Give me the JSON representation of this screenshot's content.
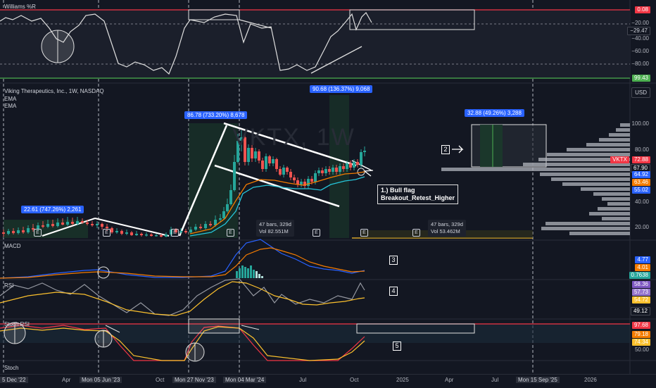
{
  "williams": {
    "title": "Williams %R",
    "value_top": "0.08",
    "value_bottom": "99.43",
    "ticks": [
      "−20.00",
      "−29.47",
      "−40.00",
      "−60.00",
      "−80.00"
    ]
  },
  "main": {
    "title": "Viking Therapeutics, Inc., 1W, NASDAQ",
    "ema1": "EMA",
    "ema2": "EMA",
    "currency": "USD",
    "watermark": "VKTX, 1W",
    "symbol_tag": "VKTX",
    "ticks": [
      "100.00",
      "80.00",
      "60.00",
      "40.00",
      "20.00"
    ],
    "price_tags": [
      {
        "value": "72.88",
        "color": "#f23645"
      },
      {
        "value": "67.90",
        "color": "#131722"
      },
      {
        "value": "64.92",
        "color": "#2962ff"
      },
      {
        "value": "63.46",
        "color": "#f57c00"
      },
      {
        "value": "55.02",
        "color": "#2962ff"
      }
    ],
    "measure1": "22.61 (747.26%) 2,261",
    "measure2": "86.78 (733.20%) 8,678",
    "measure3": "90.68 (136.37%) 9,068",
    "measure4": "32.88 (49.26%) 3,288",
    "bars1_line1": "47 bars, 329d",
    "bars1_line2": "Vol 82.551M",
    "bars2_line1": "47 bars, 329d",
    "bars2_line2": "Vol 53.462M",
    "note_line1": "1.) Bull flag",
    "note_line2": "Breakout_Retest_Higher",
    "marker2": "2",
    "earnings": "E"
  },
  "macd": {
    "title": "MACD",
    "marker": "3",
    "values": [
      {
        "v": "4.77",
        "c": "#2962ff"
      },
      {
        "v": "4.01",
        "c": "#f57c00"
      },
      {
        "v": "0.7638",
        "c": "#26a69a"
      }
    ]
  },
  "rsi": {
    "title": "RSI",
    "marker": "4",
    "values": [
      {
        "v": "58.36",
        "c": "#7e57c2"
      },
      {
        "v": "57.73",
        "c": "#9575cd"
      },
      {
        "v": "54.72",
        "c": "#fbc02d"
      },
      {
        "v": "49.12",
        "c": "#131722"
      }
    ]
  },
  "stoch_rsi": {
    "title": "Stoch RSI",
    "marker": "5",
    "values": [
      {
        "v": "97.68",
        "c": "#f23645"
      },
      {
        "v": "79.18",
        "c": "#f57c00"
      },
      {
        "v": "74.34",
        "c": "#fbc02d"
      }
    ],
    "tick": "50.00"
  },
  "stoch": {
    "title": "Stoch"
  },
  "timeline": [
    {
      "t": "5 Dec '22",
      "hi": true
    },
    {
      "t": "Apr",
      "hi": false
    },
    {
      "t": "Mon 05 Jun '23",
      "hi": true
    },
    {
      "t": "Oct",
      "hi": false
    },
    {
      "t": "Mon 27 Nov '23",
      "hi": true
    },
    {
      "t": "Mon 04 Mar '24",
      "hi": true
    },
    {
      "t": "Jul",
      "hi": false
    },
    {
      "t": "Oct",
      "hi": false
    },
    {
      "t": "2025",
      "hi": false
    },
    {
      "t": "Apr",
      "hi": false
    },
    {
      "t": "Jul",
      "hi": false
    },
    {
      "t": "Mon 15 Sep '25",
      "hi": true
    },
    {
      "t": "2026",
      "hi": false
    }
  ],
  "colors": {
    "bg": "#131722",
    "up": "#26a69a",
    "down": "#ef5350",
    "accent": "#2962ff",
    "red": "#f23645",
    "green": "#4caf50"
  }
}
